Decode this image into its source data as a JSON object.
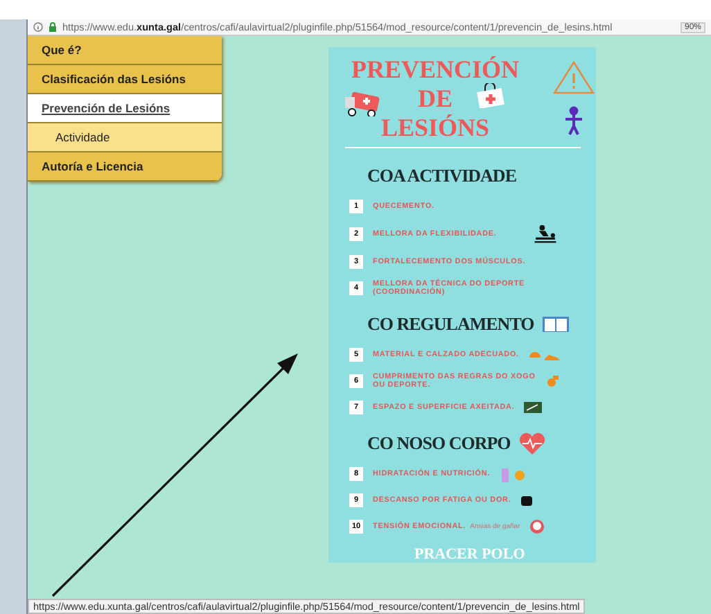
{
  "browser": {
    "url": "https://www.edu.**xunta.gal**/centros/cafi/aulavirtual2/pluginfile.php/51564/mod_resource/content/1/prevencin_de_lesins.html",
    "zoom": "90%"
  },
  "sidebar": {
    "items": [
      {
        "label": "Que é?",
        "kind": "section",
        "selected": false
      },
      {
        "label": "Clasificación das Lesións",
        "kind": "section",
        "selected": false
      },
      {
        "label": "Prevención de Lesións",
        "kind": "section",
        "selected": true
      },
      {
        "label": "Actividade",
        "kind": "subsection",
        "selected": false
      },
      {
        "label": "Autoría e Licencia",
        "kind": "section",
        "selected": false
      }
    ]
  },
  "poster": {
    "title": [
      "PREVENCIÓN",
      "DE",
      "LESIÓNS"
    ],
    "sections": [
      {
        "heading": "COA ACTIVIDADE",
        "items": [
          {
            "number": "1",
            "text": "QUECEMENTO."
          },
          {
            "number": "2",
            "text": "MELLORA DA FLEXIBILIDADE."
          },
          {
            "number": "3",
            "text": "FORTALECEMENTO DOS MÚSCULOS."
          },
          {
            "number": "4",
            "text": "MELLORA DA TÉCNICA DO DEPORTE (COORDINACIÓN)"
          }
        ]
      },
      {
        "heading": "CO REGULAMENTO",
        "items": [
          {
            "number": "5",
            "text": "MATERIAL E CALZADO ADECUADO."
          },
          {
            "number": "6",
            "text": "CUMPRIMENTO DAS REGRAS  DO XOGO OU DEPORTE."
          },
          {
            "number": "7",
            "text": "ESPAZO E SUPERFICIE AXEITADA."
          }
        ]
      },
      {
        "heading": "CO NOSO CORPO",
        "items": [
          {
            "number": "8",
            "text": "HIDRATACIÓN E NUTRICIÓN."
          },
          {
            "number": "9",
            "text": "DESCANSO POR FATIGA OU DOR."
          },
          {
            "number": "10",
            "text": "TENSIÓN EMOCIONAL.",
            "note": "Ansias de gañar"
          }
        ]
      }
    ],
    "footer_heading": "PRACER POLO"
  },
  "status_bar": {
    "url": "https://www.edu.xunta.gal/centros/cafi/aulavirtual2/pluginfile.php/51564/mod_resource/content/1/prevencin_de_lesins.html"
  }
}
